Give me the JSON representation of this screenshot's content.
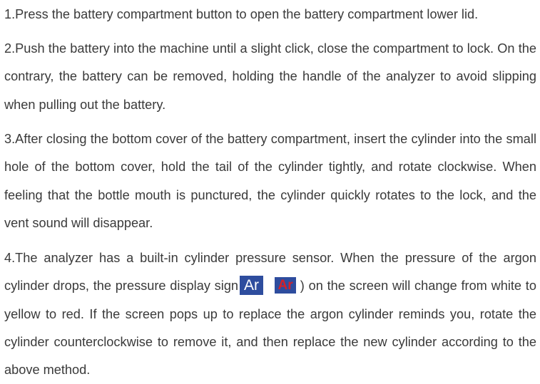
{
  "steps": [
    {
      "text": "1.Press the battery compartment button to open the battery compartment lower lid."
    },
    {
      "text": "2.Push the battery into the machine until a slight click, close the compartment to lock. On the contrary, the battery can be removed, holding the handle of the analyzer to avoid slipping when pulling out the battery."
    },
    {
      "text": "3.After closing the bottom cover of the battery compartment, insert the cylinder into the small hole of the bottom cover, hold the tail of the cylinder tightly, and rotate clockwise. When feeling that the bottle mouth is punctured, the cylinder quickly rotates to the lock, and the vent sound will disappear."
    },
    {
      "text_before_sign": "4.The analyzer has a built-in cylinder pressure sensor. When the pressure of the argon cylinder drops, the pressure display sign",
      "sign_white_label": "Ar",
      "sign_red_label": "Ar",
      "text_after_sign": " ) on the screen will change from white to yellow to red. If the screen pops up to replace the argon cylinder reminds you, rotate the cylinder counterclockwise to remove it, and then replace the new cylinder according to the above method."
    }
  ],
  "colors": {
    "text": "#3a3a3a",
    "sign_background": "#2e4d9e",
    "sign_white_text": "#ffffff",
    "sign_red_text": "#d3212a"
  }
}
